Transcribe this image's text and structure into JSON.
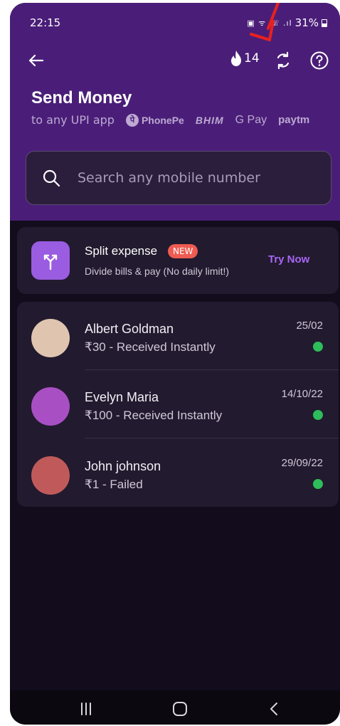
{
  "status_bar": {
    "time": "22:15",
    "icons": "▣ ᯤ ☏ .ıl",
    "battery": "31%"
  },
  "header": {
    "streak_count": "14",
    "title": "Send Money",
    "subtitle": "to any UPI app",
    "upi_apps": {
      "phonepe": "PhonePe",
      "bhim": "BHIM",
      "gpay": "G Pay",
      "paytm": "paytm"
    }
  },
  "search": {
    "placeholder": "Search any mobile number",
    "value": ""
  },
  "split_expense": {
    "title": "Split expense",
    "badge": "NEW",
    "description": "Divide bills & pay (No daily limit!)",
    "action": "Try Now"
  },
  "contacts": [
    {
      "name": "Albert Goldman",
      "status": "₹30 - Received Instantly",
      "date": "25/02",
      "avatar_color": "#dfc4b0"
    },
    {
      "name": "Evelyn Maria",
      "status": "₹100 - Received Instantly",
      "date": "14/10/22",
      "avatar_color": "#a94fc4"
    },
    {
      "name": "John johnson",
      "status": "₹1 - Failed",
      "date": "29/09/22",
      "avatar_color": "#c05a5a"
    }
  ],
  "colors": {
    "header_purple": "#4a1e78",
    "background": "#120c1c",
    "card": "#221a2e",
    "accent": "#a866f5",
    "success_dot": "#2dbd5a",
    "new_badge": "#ef5b52",
    "annotation_arrow": "#e8211f"
  }
}
